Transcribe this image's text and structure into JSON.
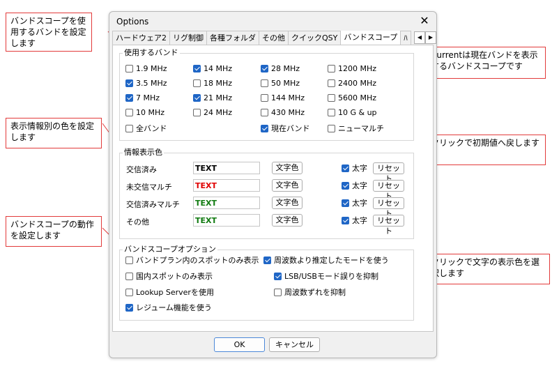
{
  "callouts": {
    "band_select": "バンドスコープを使用するバンドを設定します",
    "current_band": "Currentは現在バンドを表示するバンドスコープです",
    "info_color": "表示情報別の色を設定します",
    "reset": "クリックで初期値へ戻します",
    "behavior": "バンドスコープの動作を設定します",
    "text_color": "クリックで文字の表示色を選択します"
  },
  "dialog": {
    "title": "Options",
    "close_glyph": "✕",
    "tabs": [
      {
        "label": "ハードウェア2"
      },
      {
        "label": "リグ制御"
      },
      {
        "label": "各種フォルダ"
      },
      {
        "label": "その他"
      },
      {
        "label": "クイックQSY"
      },
      {
        "label": "バンドスコープ"
      },
      {
        "label": "ﾊ"
      }
    ],
    "tab_scroll_left": "◀",
    "tab_scroll_right": "▶",
    "colors": {
      "red": "#e00000",
      "black": "#000000",
      "green": "#107a10",
      "accent": "#1f66c6"
    }
  },
  "bands": {
    "label": "使用するバンド",
    "items": [
      {
        "label": "1.9 MHz",
        "checked": false
      },
      {
        "label": "14 MHz",
        "checked": true
      },
      {
        "label": "28 MHz",
        "checked": true
      },
      {
        "label": "1200 MHz",
        "checked": false
      },
      {
        "label": "3.5 MHz",
        "checked": true
      },
      {
        "label": "18 MHz",
        "checked": false
      },
      {
        "label": "50 MHz",
        "checked": false
      },
      {
        "label": "2400 MHz",
        "checked": false
      },
      {
        "label": "7 MHz",
        "checked": true
      },
      {
        "label": "21 MHz",
        "checked": true
      },
      {
        "label": "144 MHz",
        "checked": false
      },
      {
        "label": "5600 MHz",
        "checked": false
      },
      {
        "label": "10 MHz",
        "checked": false
      },
      {
        "label": "24 MHz",
        "checked": false
      },
      {
        "label": "430 MHz",
        "checked": false
      },
      {
        "label": "10 G & up",
        "checked": false
      },
      {
        "label": "全バンド",
        "checked": false
      },
      {
        "label": "現在バンド",
        "checked": true
      },
      {
        "label": "ニューマルチ",
        "checked": false
      }
    ]
  },
  "info": {
    "label": "情報表示色",
    "rows": [
      {
        "label": "交信済み",
        "sample": "TEXT",
        "color": "#000000",
        "color_btn": "文字色",
        "bold_label": "太字",
        "bold": true,
        "reset": "リセット"
      },
      {
        "label": "未交信マルチ",
        "sample": "TEXT",
        "color": "#e00000",
        "color_btn": "文字色",
        "bold_label": "太字",
        "bold": true,
        "reset": "リセット"
      },
      {
        "label": "交信済みマルチ",
        "sample": "TEXT",
        "color": "#107a10",
        "color_btn": "文字色",
        "bold_label": "太字",
        "bold": true,
        "reset": "リセット"
      },
      {
        "label": "その他",
        "sample": "TEXT",
        "color": "#107a10",
        "color_btn": "文字色",
        "bold_label": "太字",
        "bold": true,
        "reset": "リセット"
      }
    ]
  },
  "options": {
    "label": "バンドスコープオプション",
    "items": [
      {
        "label": "バンドプラン内のスポットのみ表示",
        "checked": false
      },
      {
        "label": "周波数より推定したモードを使う",
        "checked": true
      },
      {
        "label": "国内スポットのみ表示",
        "checked": false
      },
      {
        "label": "LSB/USBモード誤りを抑制",
        "checked": true
      },
      {
        "label": "Lookup Serverを使用",
        "checked": false
      },
      {
        "label": "周波数ずれを抑制",
        "checked": false
      },
      {
        "label": "レジューム機能を使う",
        "checked": true
      }
    ]
  },
  "buttons": {
    "ok": "OK",
    "cancel": "キャンセル"
  }
}
